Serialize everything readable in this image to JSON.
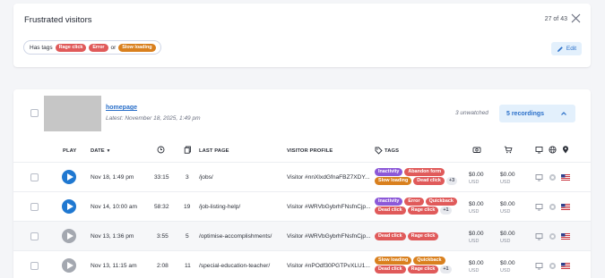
{
  "segment": {
    "title": "Frustrated visitors",
    "counter": "27 of 43",
    "filter": {
      "prefix": "Has tags",
      "tag1": "Rage click",
      "tag2": "Error",
      "joiner": "or",
      "tag3": "Slow loading"
    },
    "edit_label": "Edit"
  },
  "page_group": {
    "page_name": "homepage",
    "last_visit": "Latest: November 18, 2025, 1:49 pm",
    "unwatched": "3 unwatched",
    "recordings_label": "5 recordings"
  },
  "table": {
    "headers": {
      "play": "PLAY",
      "date": "DATE",
      "last_page": "LAST PAGE",
      "visitor_profile": "VISITOR PROFILE",
      "tags": "TAGS"
    },
    "header_icons": [
      "duration-clock-icon",
      "pages-icon",
      "tag-icon",
      "revenue-icon",
      "cart-icon",
      "device-icon",
      "browser-icon",
      "location-icon"
    ],
    "rows": [
      {
        "play_state": "unwatched",
        "date": "Nov 18, 1:49 pm",
        "duration": "33:15",
        "pages": "3",
        "last_page": "/jobs/",
        "visitor": "Visitor #nnXlxdGfnaFBZ7XDY...",
        "tags": [
          {
            "label": "Inactivity",
            "color": "purple"
          },
          {
            "label": "Abandon form",
            "color": "red"
          },
          {
            "label": "Slow loading",
            "color": "orange"
          },
          {
            "label": "Dead click",
            "color": "red"
          }
        ],
        "more": "+3",
        "revenue": "$0.00",
        "revenue_cur": "USD",
        "cart": "$0.00",
        "cart_cur": "USD"
      },
      {
        "play_state": "unwatched",
        "date": "Nov 14, 10:00 am",
        "duration": "58:32",
        "pages": "19",
        "last_page": "/job-listing-help/",
        "visitor": "Visitor #WRVbGybrhFNsfnCjp...",
        "tags": [
          {
            "label": "Inactivity",
            "color": "purple"
          },
          {
            "label": "Error",
            "color": "red"
          },
          {
            "label": "Quickback",
            "color": "red"
          },
          {
            "label": "Dead click",
            "color": "red"
          },
          {
            "label": "Rage click",
            "color": "red"
          }
        ],
        "more": "+1",
        "revenue": "$0.00",
        "revenue_cur": "USD",
        "cart": "$0.00",
        "cart_cur": "USD"
      },
      {
        "play_state": "watched",
        "date": "Nov 13, 1:36 pm",
        "duration": "3:55",
        "pages": "5",
        "last_page": "/optimise-accomplishments/",
        "visitor": "Visitor #WRVbGybrhFNsfnCjp...",
        "tags": [
          {
            "label": "Dead click",
            "color": "red"
          },
          {
            "label": "Rage click",
            "color": "red"
          }
        ],
        "more": "",
        "revenue": "$0.00",
        "revenue_cur": "USD",
        "cart": "$0.00",
        "cart_cur": "USD"
      },
      {
        "play_state": "watched",
        "date": "Nov 13, 11:15 am",
        "duration": "2:08",
        "pages": "11",
        "last_page": "/special-education-teacher/",
        "visitor": "Visitor #nPOdf30PGTPvXLU1...",
        "tags": [
          {
            "label": "Slow loading",
            "color": "orange"
          },
          {
            "label": "Quickback",
            "color": "orange"
          },
          {
            "label": "Dead click",
            "color": "red"
          },
          {
            "label": "Rage click",
            "color": "red"
          }
        ],
        "more": "+1",
        "revenue": "$0.00",
        "revenue_cur": "USD",
        "cart": "$0.00",
        "cart_cur": "USD"
      }
    ]
  },
  "colors": {
    "accent": "#1f78d1",
    "tag_red": "#e05a5a",
    "tag_orange": "#d9801e",
    "tag_purple": "#8c58d8"
  }
}
